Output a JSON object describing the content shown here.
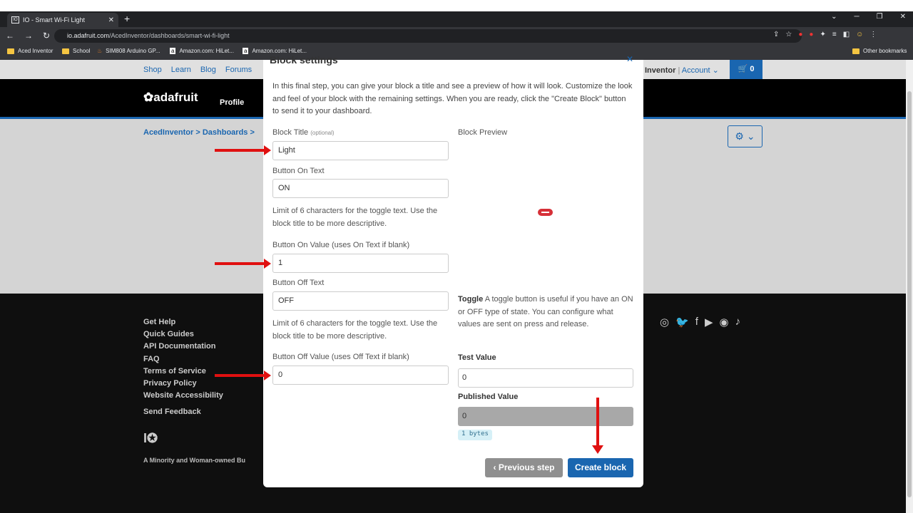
{
  "browser": {
    "tab_title": "IO - Smart Wi-Fi Light",
    "url_host": "io.adafruit.com",
    "url_path": "/AcedInventor/dashboards/smart-wi-fi-light",
    "bookmarks": [
      "Aced Inventor",
      "School",
      "SIM808 Arduino GP...",
      "Amazon.com: HiLet...",
      "Amazon.com: HiLet..."
    ],
    "other_bookmarks": "Other bookmarks"
  },
  "site": {
    "nav_links": [
      "Shop",
      "Learn",
      "Blog",
      "Forums"
    ],
    "account_user": "Inventor",
    "account_menu": "Account",
    "cart_count": "0",
    "logo_text": "adafruit",
    "profile": "Profile",
    "breadcrumb": "AcedInventor  >  Dashboards  >",
    "footer_links": [
      "Get Help",
      "Quick Guides",
      "API Documentation",
      "FAQ",
      "Terms of Service",
      "Privacy Policy",
      "Website Accessibility"
    ],
    "send_feedback": "Send Feedback",
    "footer_tagline": "A Minority and Woman-owned Bu"
  },
  "modal": {
    "title": "Block settings",
    "intro": "In this final step, you can give your block a title and see a preview of how it will look. Customize the look and feel of your block with the remaining settings. When you are ready, click the \"Create Block\" button to send it to your dashboard.",
    "block_title_label": "Block Title",
    "optional": "(optional)",
    "block_title_value": "Light",
    "on_text_label": "Button On Text",
    "on_text_value": "ON",
    "limit_note": "Limit of 6 characters for the toggle text. Use the block title to be more descriptive.",
    "on_value_label": "Button On Value (uses On Text if blank)",
    "on_value": "1",
    "off_text_label": "Button Off Text",
    "off_text_value": "OFF",
    "off_value_label": "Button Off Value (uses Off Text if blank)",
    "off_value": "0",
    "preview_label": "Block Preview",
    "toggle_name": "Toggle",
    "toggle_desc": "A toggle button is useful if you have an ON or OFF type of state. You can configure what values are sent on press and release.",
    "test_value_label": "Test Value",
    "test_value": "0",
    "published_value_label": "Published Value",
    "published_value": "0",
    "bytes": "1 bytes",
    "prev_button": "Previous step",
    "create_button": "Create block"
  }
}
